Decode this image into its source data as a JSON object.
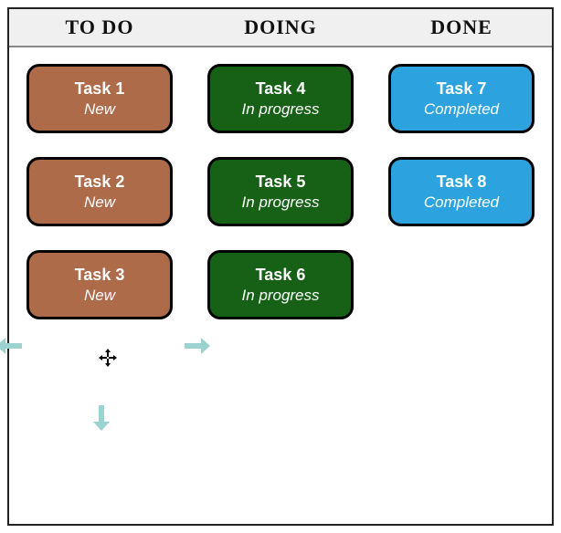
{
  "header": {
    "todo": "To Do",
    "doing": "Doing",
    "done": "Done"
  },
  "columns": {
    "todo": [
      {
        "title": "Task 1",
        "status": "New"
      },
      {
        "title": "Task 2",
        "status": "New"
      },
      {
        "title": "Task 3",
        "status": "New"
      }
    ],
    "doing": [
      {
        "title": "Task 4",
        "status": "In progress"
      },
      {
        "title": "Task 5",
        "status": "In progress"
      },
      {
        "title": "Task 6",
        "status": "In progress"
      }
    ],
    "done": [
      {
        "title": "Task 7",
        "status": "Completed"
      },
      {
        "title": "Task 8",
        "status": "Completed"
      }
    ]
  },
  "colors": {
    "todo_card": "#AD6B4A",
    "doing_card": "#176117",
    "done_card": "#2CA3DE",
    "header_bg": "#f0f0f0",
    "arrow_hint": "#9BD3D0"
  }
}
